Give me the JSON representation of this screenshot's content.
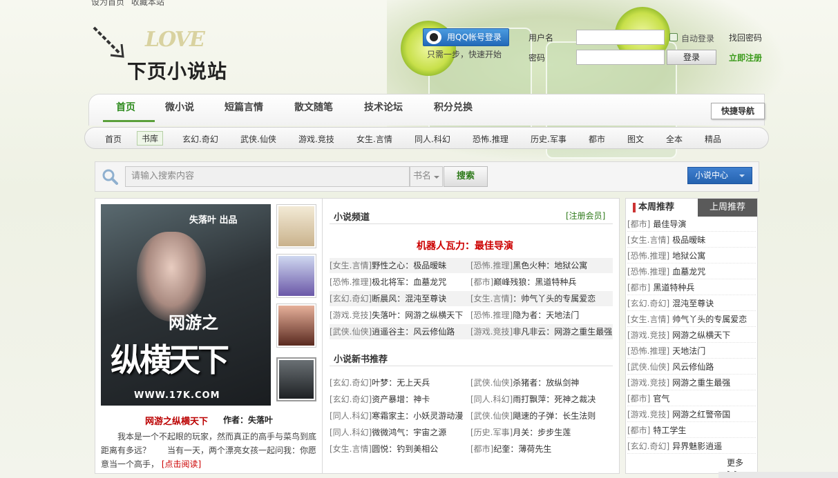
{
  "top_links": [
    "设为首页",
    "收藏本站"
  ],
  "logo": {
    "love": "LOVE",
    "title": "下页小说站"
  },
  "login": {
    "qq_button": "用QQ帐号登录",
    "one_step": "只需一步，快速开始",
    "username_label": "用户名",
    "password_label": "密码",
    "auto_login": "自动登录",
    "login_button": "登录",
    "find_password": "找回密码",
    "register": "立即注册"
  },
  "nav_main": [
    "首页",
    "微小说",
    "短篇言情",
    "散文随笔",
    "技术论坛",
    "积分兑换"
  ],
  "quick_nav": "快捷导航",
  "nav_sub": [
    "首页",
    "书库",
    "玄幻.奇幻",
    "武侠.仙侠",
    "游戏.竞技",
    "女生.言情",
    "同人.科幻",
    "恐怖.推理",
    "历史.军事",
    "都市",
    "图文",
    "全本",
    "精品"
  ],
  "search": {
    "placeholder": "请输入搜索内容",
    "type": "书名",
    "button": "搜索",
    "user_center": "小说中心"
  },
  "featured": {
    "cover_brand": "失落叶 出品",
    "cover_title_small": "网游之",
    "cover_title_big": "纵横天下",
    "cover_url": "WWW.17K.COM",
    "book_name": "网游之纵横天下",
    "author": "作者：失落叶",
    "description": "我本是一个不起眼的玩家，然而真正的高手与菜鸟到底距离有多远？　　当有一天，两个漂亮女孩一起问我：你愿意当一个高手，",
    "read_link": "[点击阅读]"
  },
  "channel": {
    "title": "小说频道",
    "register_member": "[注册会员]",
    "headline": "机器人瓦力：最佳导演",
    "rows": [
      [
        {
          "cat": "[女生.言情]",
          "title": "野性之心：极品暧昧"
        },
        {
          "cat": "[恐怖.推理]",
          "title": "黑色火种：地狱公寓"
        }
      ],
      [
        {
          "cat": "[恐怖.推理]",
          "title": "极北将军：血墓龙咒"
        },
        {
          "cat": "[都市]",
          "title": "巅峰残狼：黑道特种兵"
        }
      ],
      [
        {
          "cat": "[玄幻.奇幻]",
          "title": "断晨风：混沌至尊诀"
        },
        {
          "cat": "[女生.言情]",
          "title": "：帅气丫头的专属爱恋"
        }
      ],
      [
        {
          "cat": "[游戏.竞技]",
          "title": "失落叶：网游之纵横天下"
        },
        {
          "cat": "[恐怖.推理]",
          "title": "隐为者：天地法门"
        }
      ],
      [
        {
          "cat": "[武侠.仙侠]",
          "title": "逍遥谷主：风云修仙路"
        },
        {
          "cat": "[游戏.竞技]",
          "title": "非凡非云：网游之重生最强"
        }
      ]
    ]
  },
  "new_books": {
    "title": "小说新书推荐",
    "rows": [
      [
        {
          "cat": "[玄幻.奇幻]",
          "title": "叶梦：无上天兵"
        },
        {
          "cat": "[武侠.仙侠]",
          "title": "杀猪者：放纵剑神"
        }
      ],
      [
        {
          "cat": "[玄幻.奇幻]",
          "title": "资产暴增：神卡"
        },
        {
          "cat": "[同人.科幻]",
          "title": "雨打飘萍：死神之裁决"
        }
      ],
      [
        {
          "cat": "[同人.科幻]",
          "title": "寒霜家主：小妖灵游动漫"
        },
        {
          "cat": "[武侠.仙侠]",
          "title": "飓速的子弹：长生法则"
        }
      ],
      [
        {
          "cat": "[同人.科幻]",
          "title": "微微鸿气：宇宙之源"
        },
        {
          "cat": "[历史.军事]",
          "title": "月关：步步生莲"
        }
      ],
      [
        {
          "cat": "[女生.言情]",
          "title": "圆悦：钓到美相公"
        },
        {
          "cat": "[都市]",
          "title": "纪奎：薄荷先生"
        }
      ]
    ]
  },
  "weekly": {
    "tab_active": "本周推荐",
    "tab_inactive": "上周推荐",
    "items": [
      {
        "cat": "[都市]",
        "title": "最佳导演"
      },
      {
        "cat": "[女生.言情]",
        "title": "极品暧昧"
      },
      {
        "cat": "[恐怖.推理]",
        "title": "地狱公寓"
      },
      {
        "cat": "[恐怖.推理]",
        "title": "血墓龙咒"
      },
      {
        "cat": "[都市]",
        "title": "黑道特种兵"
      },
      {
        "cat": "[玄幻.奇幻]",
        "title": "混沌至尊诀"
      },
      {
        "cat": "[女生.言情]",
        "title": "帅气丫头的专属爱恋"
      },
      {
        "cat": "[游戏.竞技]",
        "title": "网游之纵横天下"
      },
      {
        "cat": "[恐怖.推理]",
        "title": "天地法门"
      },
      {
        "cat": "[武侠.仙侠]",
        "title": "风云修仙路"
      },
      {
        "cat": "[游戏.竞技]",
        "title": "网游之重生最强"
      },
      {
        "cat": "[都市]",
        "title": "官气"
      },
      {
        "cat": "[游戏.竞技]",
        "title": "网游之红警帝国"
      },
      {
        "cat": "[都市]",
        "title": "特工学生"
      },
      {
        "cat": "[玄幻.奇幻]",
        "title": "异界魅影逍遥"
      }
    ],
    "more": "更多>>"
  },
  "colors": {
    "accent_green": "#2e8b1e",
    "headline_red": "#cc0000",
    "qq_blue": "#2269b8"
  }
}
